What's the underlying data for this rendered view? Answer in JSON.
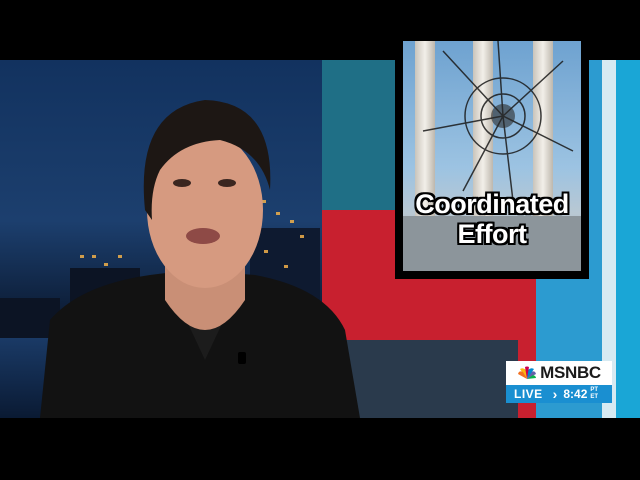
{
  "headline": {
    "line1": "Coordinated",
    "line2": "Effort"
  },
  "network": {
    "name": "MSNBC"
  },
  "bug": {
    "live": "LIVE",
    "separator": "›",
    "time": "8:42",
    "zone_top": "PT",
    "zone_bottom": "ET"
  },
  "colors": {
    "accent_red": "#c8202f",
    "accent_teal": "#1aa6d6",
    "bug_blue": "#1a8fd1",
    "text_white": "#ffffff"
  }
}
